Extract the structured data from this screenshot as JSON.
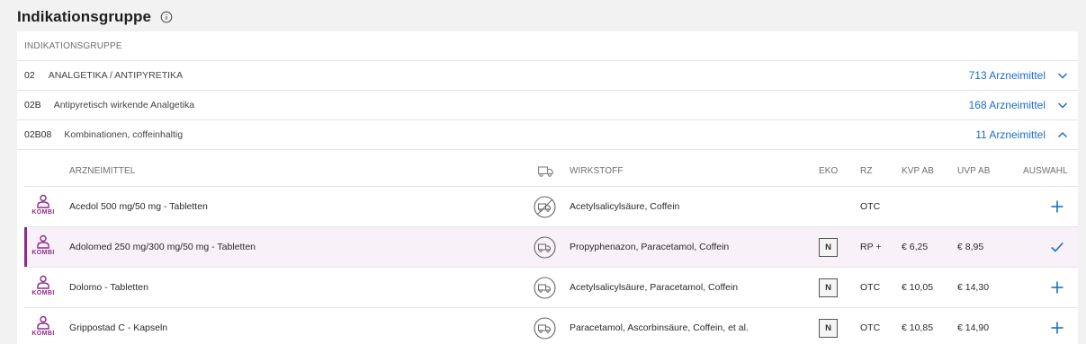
{
  "page": {
    "title": "Indikationsgruppe",
    "info_icon": "info-icon"
  },
  "panel": {
    "header": "INDIKATIONSGRUPPE",
    "groups": [
      {
        "code": "02",
        "name": "ANALGETIKA / ANTIPYRETIKA",
        "count": "713 Arzneimittel",
        "state": "collapsed"
      },
      {
        "code": "02B",
        "name": "Antipyretisch wirkende Analgetika",
        "count": "168 Arzneimittel",
        "state": "collapsed"
      },
      {
        "code": "02B08",
        "name": "Kombinationen, coffeinhaltig",
        "count": "11 Arzneimittel",
        "state": "expanded"
      }
    ]
  },
  "table": {
    "columns": {
      "arzneimittel": "ARZNEIMITTEL",
      "delivery_icon": "truck-icon",
      "wirkstoff": "WIRKSTOFF",
      "eko": "EKO",
      "rz": "RZ",
      "kvp": "KVP AB",
      "uvp": "UVP AB",
      "auswahl": "AUSWAHL"
    },
    "rows": [
      {
        "badge": "KOMBI",
        "name": "Acedol 500 mg/50 mg - Tabletten",
        "delivery": "not-deliverable",
        "wirkstoff": "Acetylsalicylsäure, Coffein",
        "eko": "",
        "rz": "OTC",
        "kvp": "",
        "uvp": "",
        "action": "add",
        "selected": false
      },
      {
        "badge": "KOMBI",
        "name": "Adolomed 250 mg/300 mg/50 mg - Tabletten",
        "delivery": "deliverable",
        "wirkstoff": "Propyphenazon, Paracetamol, Coffein",
        "eko": "N",
        "rz": "RP +",
        "kvp": "€ 6,25",
        "uvp": "€ 8,95",
        "action": "selected",
        "selected": true
      },
      {
        "badge": "KOMBI",
        "name": "Dolomo - Tabletten",
        "delivery": "deliverable",
        "wirkstoff": "Acetylsalicylsäure, Paracetamol, Coffein",
        "eko": "N",
        "rz": "OTC",
        "kvp": "€ 10,05",
        "uvp": "€ 14,30",
        "action": "add",
        "selected": false
      },
      {
        "badge": "KOMBI",
        "name": "Grippostad C - Kapseln",
        "delivery": "deliverable",
        "wirkstoff": "Paracetamol, Ascorbinsäure, Coffein, et al.",
        "eko": "N",
        "rz": "OTC",
        "kvp": "€ 10,85",
        "uvp": "€ 14,90",
        "action": "add",
        "selected": false
      }
    ]
  },
  "colors": {
    "link_blue": "#1a6ec9",
    "kombi_purple": "#8e2a8b",
    "selected_row_bg": "#f8f1f8"
  }
}
